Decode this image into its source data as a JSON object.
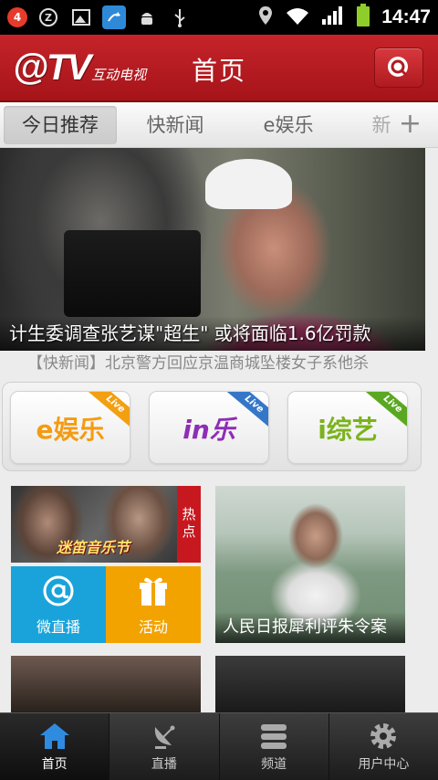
{
  "status_bar": {
    "notification_count": "4",
    "time": "14:47"
  },
  "header": {
    "logo_main": "@TV",
    "logo_sub": "互动电视",
    "title": "首页",
    "search_icon": "search-icon"
  },
  "tabs": [
    {
      "label": "今日推荐",
      "active": true
    },
    {
      "label": "快新闻",
      "active": false
    },
    {
      "label": "e娱乐",
      "active": false
    },
    {
      "label": "新",
      "active": false
    }
  ],
  "tab_add": "+",
  "hero": {
    "caption": "计生委调查张艺谋\"超生\" 或将面临1.6亿罚款",
    "ticker": "【快新闻】北京警方回应京温商城坠楼女子系他杀"
  },
  "channels": [
    {
      "name": "e娱乐",
      "text": "e娱乐",
      "badge": "Live",
      "color": "#f39c12"
    },
    {
      "name": "in乐",
      "text": "in乐",
      "badge": "Live",
      "color": "#8e2db5"
    },
    {
      "name": "i综艺",
      "text": "i综艺",
      "badge": "Live",
      "color": "#7ab31b"
    }
  ],
  "grid": {
    "music_festival": {
      "label": "迷笛音乐节",
      "hot_tag": "热点"
    },
    "weizhibo": {
      "label": "微直播",
      "color": "#1aa3da"
    },
    "huodong": {
      "label": "活动",
      "color": "#f2a300"
    },
    "news_story": {
      "label": "人民日报犀利评朱令案"
    }
  },
  "bottom_nav": [
    {
      "label": "首页",
      "icon": "home-icon",
      "active": true
    },
    {
      "label": "直播",
      "icon": "satellite-dish-icon",
      "active": false
    },
    {
      "label": "频道",
      "icon": "stack-icon",
      "active": false
    },
    {
      "label": "用户中心",
      "icon": "gear-icon",
      "active": false
    }
  ]
}
